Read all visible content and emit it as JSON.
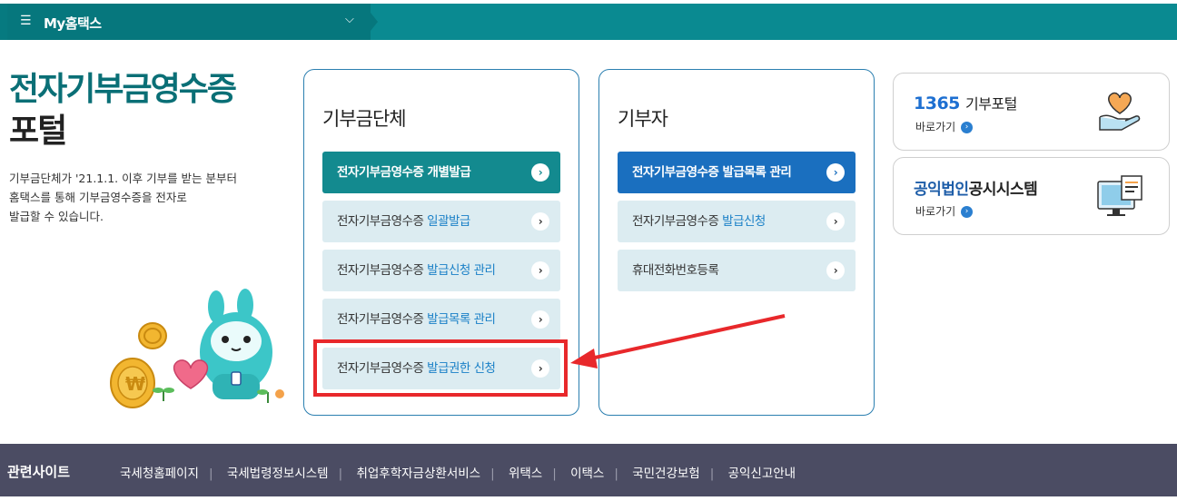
{
  "topbar": {
    "menu_icon": "hamburger-icon",
    "title": "My홈택스",
    "dropdown_icon": "chevron-down-icon"
  },
  "hero": {
    "title_line1": "전자기부금영수증",
    "title_line2": "포털",
    "desc_line1": "기부금단체가 '21.1.1. 이후 기부를 받는 분부터",
    "desc_line2": "홈택스를 통해 기부금영수증을 전자로",
    "desc_line3": "발급할 수 있습니다."
  },
  "panel_org": {
    "heading": "기부금단체",
    "buttons": [
      {
        "prefix": "전자기부금영수증 개별발급",
        "highlight": ""
      },
      {
        "prefix": "전자기부금영수증 ",
        "highlight": "일괄발급"
      },
      {
        "prefix": "전자기부금영수증 ",
        "highlight": "발급신청 관리"
      },
      {
        "prefix": "전자기부금영수증 ",
        "highlight": "발급목록 관리"
      },
      {
        "prefix": "전자기부금영수증 ",
        "highlight": "발급권한 신청"
      }
    ]
  },
  "panel_donor": {
    "heading": "기부자",
    "buttons": [
      {
        "prefix": "전자기부금영수증 발급목록 관리",
        "highlight": ""
      },
      {
        "prefix": "전자기부금영수증 ",
        "highlight": "발급신청"
      },
      {
        "prefix": "휴대전화번호등록",
        "highlight": ""
      }
    ]
  },
  "cards": {
    "c1_num": "1365",
    "c1_name": "기부포털",
    "c1_go": "바로가기",
    "c2_name_blue": "공익법인",
    "c2_name_rest": "공시시스템",
    "c2_go": "바로가기"
  },
  "footer": {
    "label": "관련사이트",
    "links": [
      "국세청홈페이지",
      "국세법령정보시스템",
      "취업후학자금상환서비스",
      "위택스",
      "이택스",
      "국민건강보험",
      "공익신고안내"
    ]
  },
  "colors": {
    "teal": "#0a8a91",
    "primary_btn": "#138a8f",
    "blue_btn": "#1a6fbf",
    "highlight_red": "#e8282b",
    "footer_bg": "#4b4c63"
  }
}
